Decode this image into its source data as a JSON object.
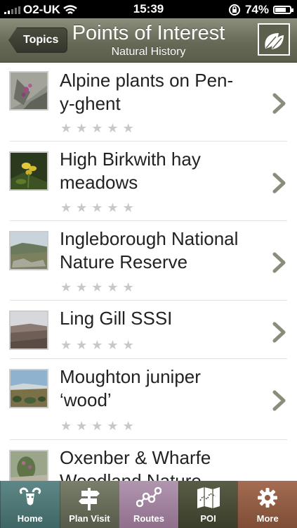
{
  "status": {
    "carrier": "O2-UK",
    "time": "15:39",
    "battery": "74%",
    "battery_level": 0.74
  },
  "nav": {
    "back_label": "Topics",
    "title": "Points of Interest",
    "subtitle": "Natural History",
    "action_icon": "leaf-icon"
  },
  "items": [
    {
      "title": "Alpine plants on Pen-y-ghent",
      "title_line1": "Alpine plants on Pen-",
      "title_line2": "y-ghent",
      "rating": 0,
      "max_rating": 5
    },
    {
      "title": "High Birkwith hay meadows",
      "title_line1": "High Birkwith hay",
      "title_line2": "meadows",
      "rating": 0,
      "max_rating": 5
    },
    {
      "title": "Ingleborough National Nature Reserve",
      "title_line1": "Ingleborough National",
      "title_line2": "Nature Reserve",
      "rating": 0,
      "max_rating": 5
    },
    {
      "title": "Ling Gill SSSI",
      "title_line1": "Ling Gill SSSI",
      "title_line2": "",
      "rating": 0,
      "max_rating": 5
    },
    {
      "title": "Moughton juniper ‘wood’",
      "title_line1": "Moughton juniper",
      "title_line2": "‘wood’",
      "rating": 0,
      "max_rating": 5
    },
    {
      "title": "Oxenber & Wharfe Woodland Nature",
      "title_line1": "Oxenber & Wharfe",
      "title_line2": "Woodland Nature",
      "rating": 0,
      "max_rating": 5
    }
  ],
  "tabs": [
    {
      "label": "Home",
      "icon": "ram-icon",
      "color": "#4f7776"
    },
    {
      "label": "Plan Visit",
      "icon": "signpost-icon",
      "color": "#676b59"
    },
    {
      "label": "Routes",
      "icon": "route-icon",
      "color": "#a0839e"
    },
    {
      "label": "POI",
      "icon": "map-icon",
      "color": "#4a4d37",
      "selected": true
    },
    {
      "label": "More",
      "icon": "gear-icon",
      "color": "#925d44"
    }
  ]
}
